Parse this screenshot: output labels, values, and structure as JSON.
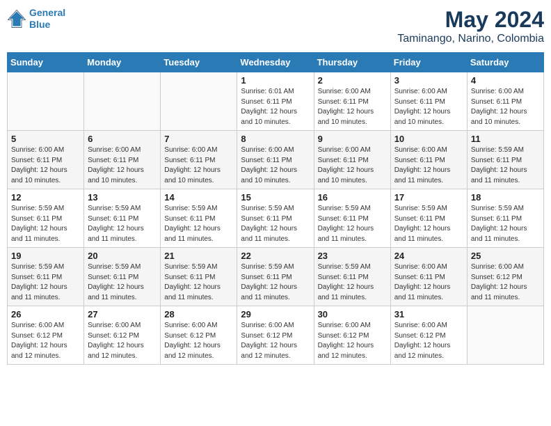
{
  "header": {
    "logo_line1": "General",
    "logo_line2": "Blue",
    "month": "May 2024",
    "location": "Taminango, Narino, Colombia"
  },
  "days_of_week": [
    "Sunday",
    "Monday",
    "Tuesday",
    "Wednesday",
    "Thursday",
    "Friday",
    "Saturday"
  ],
  "weeks": [
    [
      {
        "day": "",
        "info": ""
      },
      {
        "day": "",
        "info": ""
      },
      {
        "day": "",
        "info": ""
      },
      {
        "day": "1",
        "info": "Sunrise: 6:01 AM\nSunset: 6:11 PM\nDaylight: 12 hours\nand 10 minutes."
      },
      {
        "day": "2",
        "info": "Sunrise: 6:00 AM\nSunset: 6:11 PM\nDaylight: 12 hours\nand 10 minutes."
      },
      {
        "day": "3",
        "info": "Sunrise: 6:00 AM\nSunset: 6:11 PM\nDaylight: 12 hours\nand 10 minutes."
      },
      {
        "day": "4",
        "info": "Sunrise: 6:00 AM\nSunset: 6:11 PM\nDaylight: 12 hours\nand 10 minutes."
      }
    ],
    [
      {
        "day": "5",
        "info": "Sunrise: 6:00 AM\nSunset: 6:11 PM\nDaylight: 12 hours\nand 10 minutes."
      },
      {
        "day": "6",
        "info": "Sunrise: 6:00 AM\nSunset: 6:11 PM\nDaylight: 12 hours\nand 10 minutes."
      },
      {
        "day": "7",
        "info": "Sunrise: 6:00 AM\nSunset: 6:11 PM\nDaylight: 12 hours\nand 10 minutes."
      },
      {
        "day": "8",
        "info": "Sunrise: 6:00 AM\nSunset: 6:11 PM\nDaylight: 12 hours\nand 10 minutes."
      },
      {
        "day": "9",
        "info": "Sunrise: 6:00 AM\nSunset: 6:11 PM\nDaylight: 12 hours\nand 10 minutes."
      },
      {
        "day": "10",
        "info": "Sunrise: 6:00 AM\nSunset: 6:11 PM\nDaylight: 12 hours\nand 11 minutes."
      },
      {
        "day": "11",
        "info": "Sunrise: 5:59 AM\nSunset: 6:11 PM\nDaylight: 12 hours\nand 11 minutes."
      }
    ],
    [
      {
        "day": "12",
        "info": "Sunrise: 5:59 AM\nSunset: 6:11 PM\nDaylight: 12 hours\nand 11 minutes."
      },
      {
        "day": "13",
        "info": "Sunrise: 5:59 AM\nSunset: 6:11 PM\nDaylight: 12 hours\nand 11 minutes."
      },
      {
        "day": "14",
        "info": "Sunrise: 5:59 AM\nSunset: 6:11 PM\nDaylight: 12 hours\nand 11 minutes."
      },
      {
        "day": "15",
        "info": "Sunrise: 5:59 AM\nSunset: 6:11 PM\nDaylight: 12 hours\nand 11 minutes."
      },
      {
        "day": "16",
        "info": "Sunrise: 5:59 AM\nSunset: 6:11 PM\nDaylight: 12 hours\nand 11 minutes."
      },
      {
        "day": "17",
        "info": "Sunrise: 5:59 AM\nSunset: 6:11 PM\nDaylight: 12 hours\nand 11 minutes."
      },
      {
        "day": "18",
        "info": "Sunrise: 5:59 AM\nSunset: 6:11 PM\nDaylight: 12 hours\nand 11 minutes."
      }
    ],
    [
      {
        "day": "19",
        "info": "Sunrise: 5:59 AM\nSunset: 6:11 PM\nDaylight: 12 hours\nand 11 minutes."
      },
      {
        "day": "20",
        "info": "Sunrise: 5:59 AM\nSunset: 6:11 PM\nDaylight: 12 hours\nand 11 minutes."
      },
      {
        "day": "21",
        "info": "Sunrise: 5:59 AM\nSunset: 6:11 PM\nDaylight: 12 hours\nand 11 minutes."
      },
      {
        "day": "22",
        "info": "Sunrise: 5:59 AM\nSunset: 6:11 PM\nDaylight: 12 hours\nand 11 minutes."
      },
      {
        "day": "23",
        "info": "Sunrise: 5:59 AM\nSunset: 6:11 PM\nDaylight: 12 hours\nand 11 minutes."
      },
      {
        "day": "24",
        "info": "Sunrise: 6:00 AM\nSunset: 6:11 PM\nDaylight: 12 hours\nand 11 minutes."
      },
      {
        "day": "25",
        "info": "Sunrise: 6:00 AM\nSunset: 6:12 PM\nDaylight: 12 hours\nand 11 minutes."
      }
    ],
    [
      {
        "day": "26",
        "info": "Sunrise: 6:00 AM\nSunset: 6:12 PM\nDaylight: 12 hours\nand 12 minutes."
      },
      {
        "day": "27",
        "info": "Sunrise: 6:00 AM\nSunset: 6:12 PM\nDaylight: 12 hours\nand 12 minutes."
      },
      {
        "day": "28",
        "info": "Sunrise: 6:00 AM\nSunset: 6:12 PM\nDaylight: 12 hours\nand 12 minutes."
      },
      {
        "day": "29",
        "info": "Sunrise: 6:00 AM\nSunset: 6:12 PM\nDaylight: 12 hours\nand 12 minutes."
      },
      {
        "day": "30",
        "info": "Sunrise: 6:00 AM\nSunset: 6:12 PM\nDaylight: 12 hours\nand 12 minutes."
      },
      {
        "day": "31",
        "info": "Sunrise: 6:00 AM\nSunset: 6:12 PM\nDaylight: 12 hours\nand 12 minutes."
      },
      {
        "day": "",
        "info": ""
      }
    ]
  ]
}
